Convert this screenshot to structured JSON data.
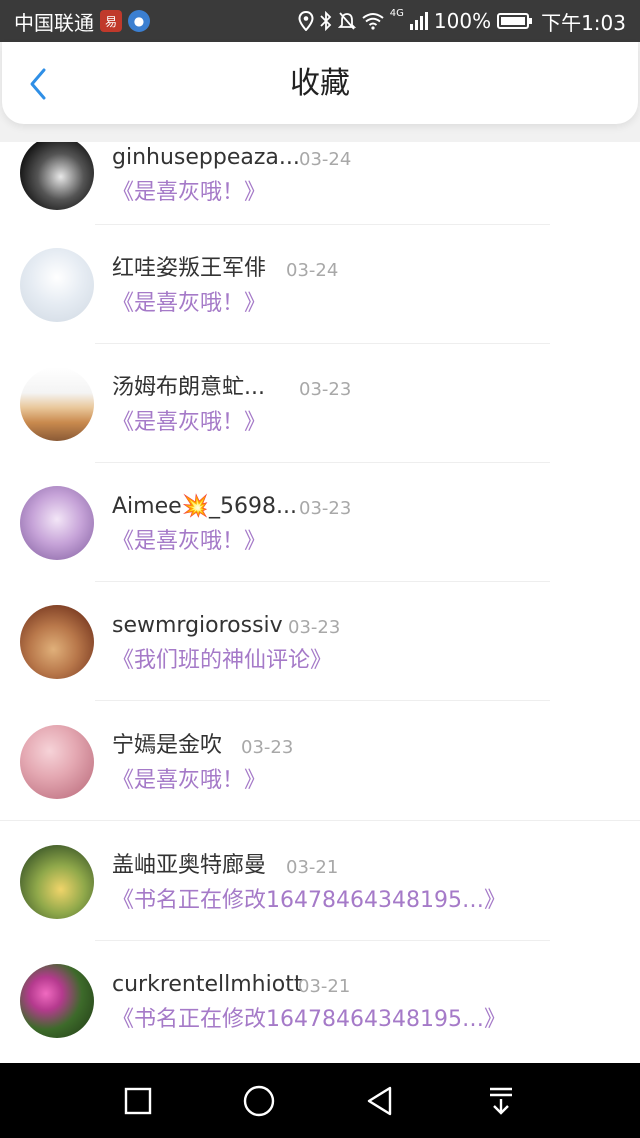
{
  "status_bar": {
    "carrier": "中国联通",
    "battery": "100%",
    "time": "下午1:03",
    "network": "4G",
    "icons": [
      "location-icon",
      "bluetooth-icon",
      "mute-icon",
      "wifi-icon",
      "signal-icon",
      "battery-icon"
    ]
  },
  "header": {
    "title": "收藏",
    "back_icon": "chevron-left-icon",
    "accent_color": "#2f8fe6"
  },
  "colors": {
    "book_title": "#a57ac8",
    "date": "#a8a8a8",
    "name": "#333333"
  },
  "list": {
    "items": [
      {
        "name": "ginhuseppeaza...",
        "date": "03-24",
        "title": "《是喜灰哦！》"
      },
      {
        "name": "红哇姿叛王军俳",
        "date": "03-24",
        "title": "《是喜灰哦！》"
      },
      {
        "name": "汤姆布朗意虻...",
        "date": "03-23",
        "title": "《是喜灰哦！》"
      },
      {
        "name": "Aimee💥_5698...",
        "date": "03-23",
        "title": "《是喜灰哦！》"
      },
      {
        "name": "sewmrgiorossiv",
        "date": "03-23",
        "title": "《我们班的神仙评论》"
      },
      {
        "name": "宁嫣是金吹",
        "date": "03-23",
        "title": "《是喜灰哦！》"
      },
      {
        "name": "盖岫亚奥特廊曼",
        "date": "03-21",
        "title": "《书名正在修改16478464348195…》"
      },
      {
        "name": "curkrentellmhiott",
        "date": "03-21",
        "title": "《书名正在修改16478464348195…》"
      }
    ]
  },
  "nav_bar": {
    "icons": [
      "square-icon",
      "circle-icon",
      "back-triangle-icon",
      "notification-pull-icon"
    ]
  }
}
